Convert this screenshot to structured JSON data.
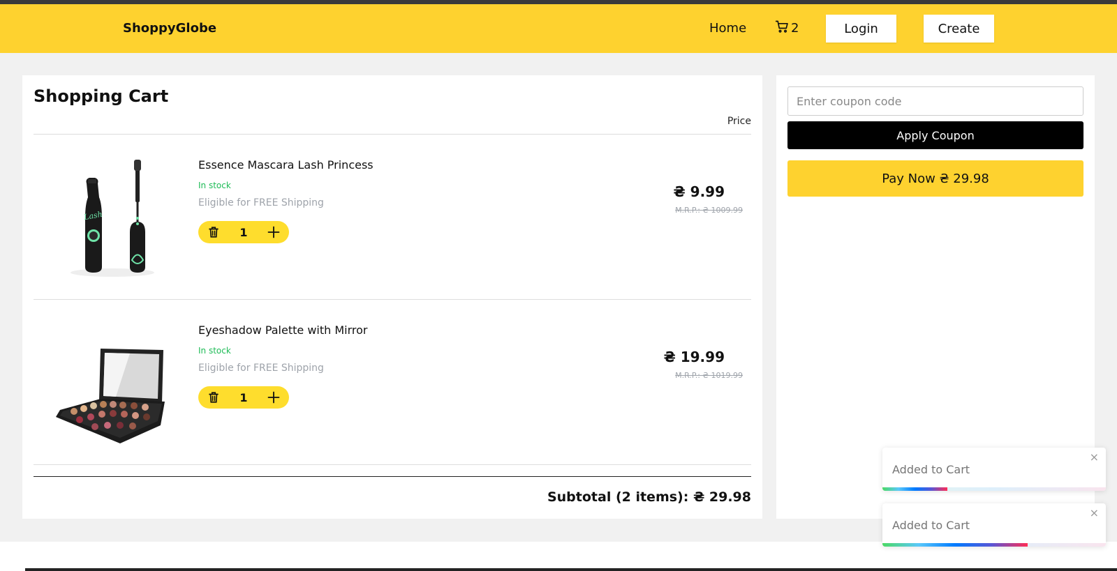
{
  "header": {
    "brand": "ShoppyGlobe",
    "home_label": "Home",
    "cart_icon": "shopping-cart-icon",
    "cart_count": "2",
    "login_label": "Login",
    "create_label": "Create",
    "bg_color": "#fed22f"
  },
  "cart": {
    "title": "Shopping Cart",
    "price_header": "Price",
    "items": [
      {
        "name": "Essence Mascara Lash Princess",
        "stock": "In stock",
        "shipping": "Eligible for FREE Shipping",
        "quantity": "1",
        "price": "₴ 9.99",
        "mrp": "M.R.P.: ₴ 1009.99"
      },
      {
        "name": "Eyeshadow Palette with Mirror",
        "stock": "In stock",
        "shipping": "Eligible for FREE Shipping",
        "quantity": "1",
        "price": "₴ 19.99",
        "mrp": "M.R.P.: ₴ 1019.99"
      }
    ],
    "subtotal": "Subtotal (2 items): ₴ 29.98"
  },
  "sidebar": {
    "coupon_placeholder": "Enter coupon code",
    "apply_label": "Apply Coupon",
    "pay_label": "Pay Now ₴ 29.98"
  },
  "toasts": [
    {
      "message": "Added to Cart",
      "close": "×",
      "progress": 0.29
    },
    {
      "message": "Added to Cart",
      "close": "×",
      "progress": 0.65
    }
  ]
}
